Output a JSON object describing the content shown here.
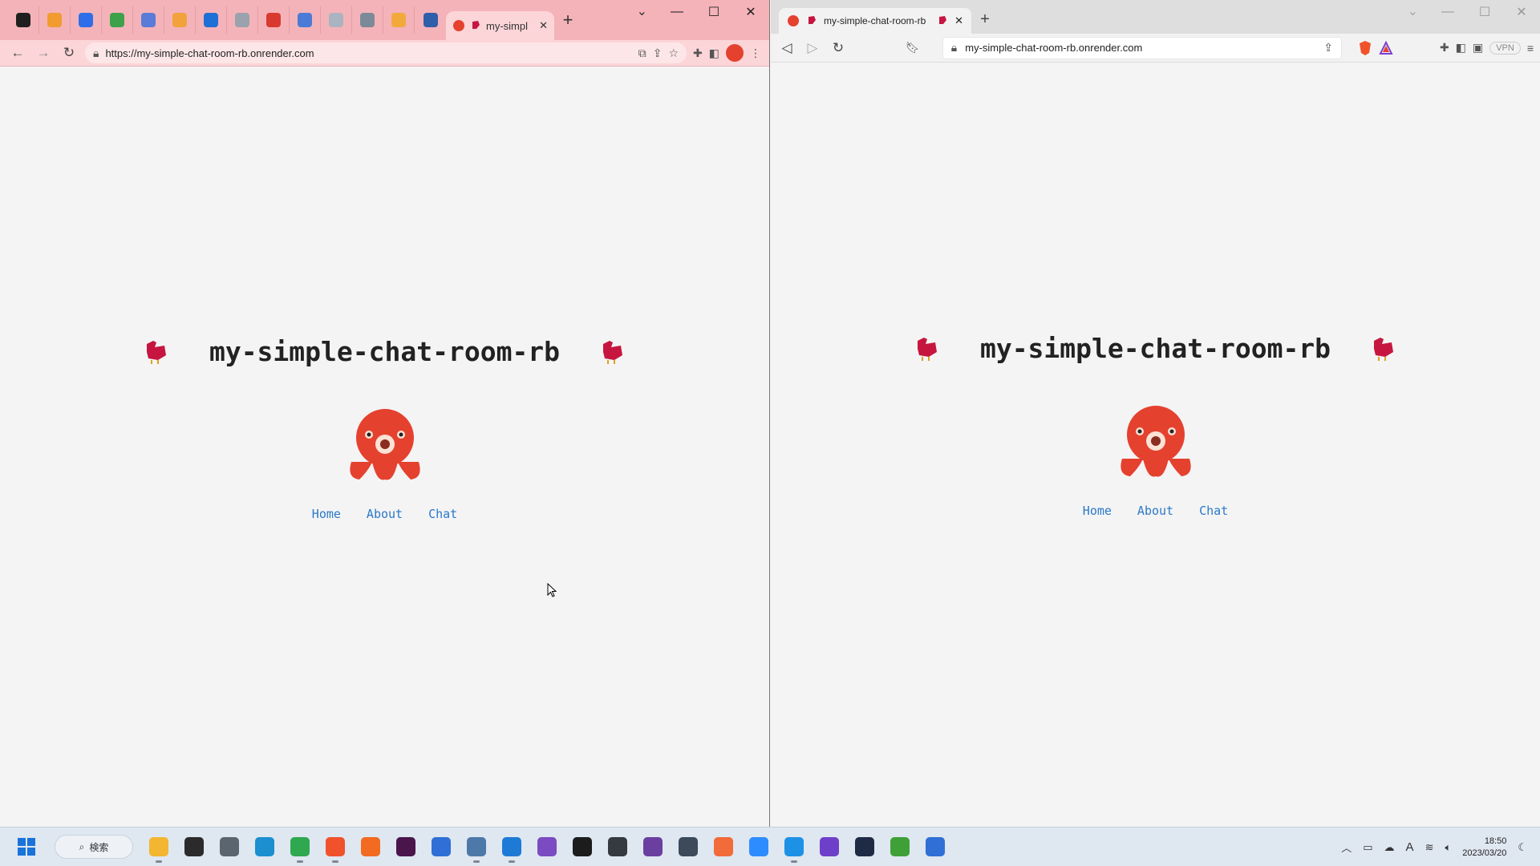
{
  "chrome": {
    "tab_title": "my-simpl",
    "url": "https://my-simple-chat-room-rb.onrender.com",
    "pinned_icons": [
      {
        "name": "github-icon",
        "color": "#1f1f1f"
      },
      {
        "name": "gitlab-icon",
        "color": "#f29b2e"
      },
      {
        "name": "jira-icon",
        "color": "#2f6ee8"
      },
      {
        "name": "circle-app-icon",
        "color": "#3da14a"
      },
      {
        "name": "slash-app-icon",
        "color": "#5a7bd8"
      },
      {
        "name": "box-app-icon",
        "color": "#f2a23c"
      },
      {
        "name": "azure-icon",
        "color": "#1f6fd6"
      },
      {
        "name": "gear-app-icon",
        "color": "#9aa2ad"
      },
      {
        "name": "gmail-icon",
        "color": "#d93a2f"
      },
      {
        "name": "calendar-app-icon",
        "color": "#4b7bd6"
      },
      {
        "name": "window-app-icon",
        "color": "#aab3c0"
      },
      {
        "name": "chatgpt-icon",
        "color": "#7a8a99"
      },
      {
        "name": "link-app-icon",
        "color": "#f2a93c"
      },
      {
        "name": "shape-app-icon",
        "color": "#2f5fa8"
      }
    ]
  },
  "brave": {
    "tab_title": "my-simple-chat-room-rb",
    "url": "my-simple-chat-room-rb.onrender.com",
    "vpn_label": "VPN"
  },
  "site": {
    "title": "my-simple-chat-room-rb",
    "nav": [
      "Home",
      "About",
      "Chat"
    ],
    "accent": "#2a78c8",
    "ruby_color": "#c6163f",
    "octocat_color": "#e5412f"
  },
  "taskbar": {
    "search_label": "検索",
    "apps": [
      {
        "name": "file-explorer-icon",
        "color": "#f2b630",
        "active": true
      },
      {
        "name": "terminal-icon",
        "color": "#2b2b2b",
        "active": false
      },
      {
        "name": "settings-icon",
        "color": "#5a6570",
        "active": false
      },
      {
        "name": "edge-icon",
        "color": "#1b8fcf",
        "active": false
      },
      {
        "name": "chrome-icon",
        "color": "#2fa84f",
        "active": true
      },
      {
        "name": "brave-icon",
        "color": "#f0522b",
        "active": true
      },
      {
        "name": "firefox-icon",
        "color": "#f26b21",
        "active": false
      },
      {
        "name": "slack-icon",
        "color": "#4a154b",
        "active": false
      },
      {
        "name": "notepad-icon",
        "color": "#2f6fd6",
        "active": false
      },
      {
        "name": "remote-desktop-icon",
        "color": "#4d79a8",
        "active": true
      },
      {
        "name": "vscode-icon",
        "color": "#1f7ad6",
        "active": true
      },
      {
        "name": "visual-studio-icon",
        "color": "#7b4bc2",
        "active": false
      },
      {
        "name": "jetbrains-icon",
        "color": "#1c1c1c",
        "active": false
      },
      {
        "name": "stack-app-icon",
        "color": "#343a40",
        "active": false
      },
      {
        "name": "purple-app-icon",
        "color": "#6b3fa0",
        "active": false
      },
      {
        "name": "globe-app-icon",
        "color": "#3c4a5a",
        "active": false
      },
      {
        "name": "postman-icon",
        "color": "#f26b3a",
        "active": false
      },
      {
        "name": "zoom-icon",
        "color": "#2d8cff",
        "active": false
      },
      {
        "name": "docker-icon",
        "color": "#1d91e6",
        "active": true
      },
      {
        "name": "github-desktop-icon",
        "color": "#6e40c9",
        "active": false
      },
      {
        "name": "hexagon-app-icon",
        "color": "#1f2a44",
        "active": false
      },
      {
        "name": "mongodb-icon",
        "color": "#3fa037",
        "active": false
      },
      {
        "name": "blocks-app-icon",
        "color": "#2f6fd6",
        "active": false
      }
    ],
    "time": "18:50",
    "date": "2023/03/20",
    "ime_label": "A"
  }
}
